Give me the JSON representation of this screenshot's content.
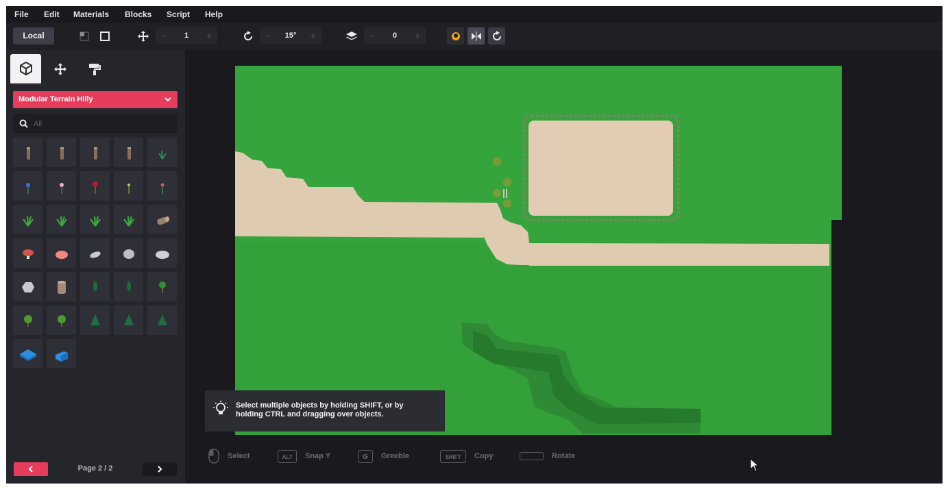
{
  "menu": {
    "items": [
      "File",
      "Edit",
      "Materials",
      "Blocks",
      "Script",
      "Help"
    ]
  },
  "toolbar": {
    "space_label": "Local",
    "move_step": {
      "value": "1",
      "minus": "−",
      "plus": "+"
    },
    "rotate_step": {
      "value": "15°",
      "minus": "−",
      "plus": "+"
    },
    "layer": {
      "value": "0",
      "minus": "−",
      "plus": "+"
    }
  },
  "sidebar": {
    "tabs": [
      "blocks",
      "transform",
      "paint"
    ],
    "category_dropdown": "Modular Terrain Hilly",
    "search_placeholder": "All",
    "items": [
      "log-post",
      "log-post",
      "log-post",
      "log-post",
      "grass-tuft",
      "blue-flower",
      "pink-flower",
      "red-flower",
      "yellow-sprout",
      "pink-bud",
      "grass-clump",
      "grass-clump",
      "grass-clump",
      "grass-clump",
      "fallen-log",
      "red-mushroom",
      "pink-rock",
      "flat-stone",
      "round-stone",
      "wide-stone",
      "boulder",
      "stump",
      "cypress-tree",
      "cypress-tree",
      "small-tree",
      "round-tree",
      "round-tree",
      "pine-tree",
      "pine-tree",
      "pine-tree",
      "blue-tile",
      "blue-ramp"
    ],
    "pager": {
      "label": "Page 2 / 2",
      "prev": "‹",
      "next": "›"
    }
  },
  "viewport": {
    "tip_text": "Select multiple objects by holding SHIFT, or by holding CTRL and dragging over objects.",
    "hints": [
      {
        "key": "",
        "label": "Select"
      },
      {
        "key": "ALT",
        "label": "Snap Y"
      },
      {
        "key": "G",
        "label": "Greeble"
      },
      {
        "key": "SHIFT",
        "label": "Copy"
      },
      {
        "key": "",
        "label": "Rotate"
      }
    ]
  },
  "colors": {
    "accent": "#e73d5d",
    "grass": "#36a43c",
    "path": "#dfcbb0",
    "panel": "#25252c"
  }
}
